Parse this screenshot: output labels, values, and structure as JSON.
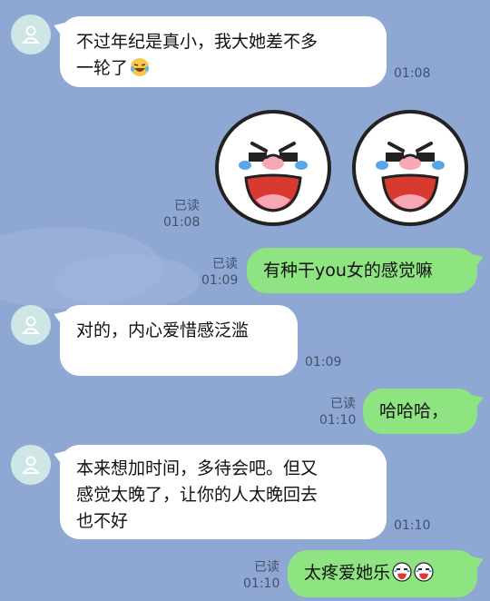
{
  "messages": [
    {
      "type": "in",
      "text_line1": "不过年纪是真小，我大她差不多",
      "text_line2": "一轮了",
      "emoji": "laughing-tears",
      "time": "01:08"
    },
    {
      "type": "out-sticker",
      "read": "已读",
      "time": "01:08",
      "sticker": "crying-laughing-face"
    },
    {
      "type": "out",
      "text": "有种干you女的感觉嘛",
      "read": "已读",
      "time": "01:09"
    },
    {
      "type": "in",
      "text": "对的，内心爱惜感泛滥",
      "time": "01:09"
    },
    {
      "type": "out",
      "text": "哈哈哈，",
      "read": "已读",
      "time": "01:10"
    },
    {
      "type": "in",
      "text_line1": "本来想加时间，多待会吧。但又",
      "text_line2": "感觉太晚了，让你的人太晚回去",
      "text_line3": "也不好",
      "time": "01:10"
    },
    {
      "type": "out",
      "text": "太疼爱她乐",
      "emoji": "crying-laughing-face",
      "read": "已读",
      "time": "01:10"
    }
  ],
  "colors": {
    "background": "#8ea7d3",
    "incoming": "#ffffff",
    "outgoing": "#8fe482",
    "avatar": "#cfe6e6"
  }
}
